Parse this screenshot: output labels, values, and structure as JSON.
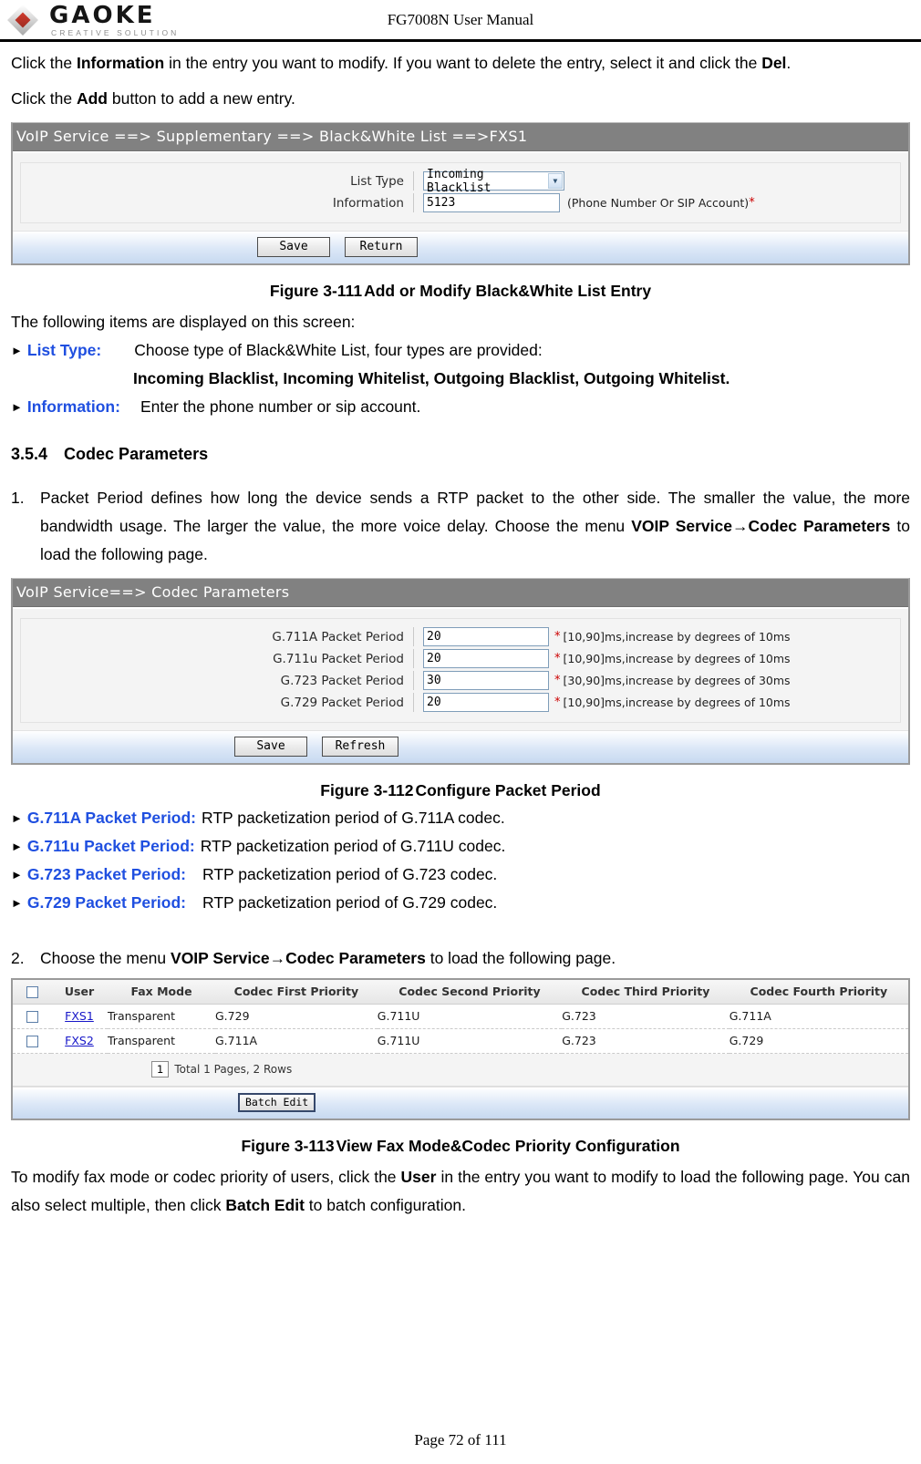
{
  "header": {
    "logo_word": "GAOKE",
    "logo_tagline": "CREATIVE SOLUTION",
    "doc_title": "FG7008N User Manual"
  },
  "intro": {
    "line1_a": "Click the ",
    "line1_b": "Information",
    "line1_c": " in the entry you want to modify. If you want to delete the entry, select it and click the ",
    "line1_d": "Del",
    "line1_e": ".",
    "line2_a": "Click the ",
    "line2_b": "Add",
    "line2_c": " button to add a new entry."
  },
  "screenshot_blacklist": {
    "title": "VoIP Service ==> Supplementary ==> Black&White List ==>FXS1",
    "fields": [
      {
        "label": "List Type",
        "type": "select",
        "value": "Incoming Blacklist",
        "icon": "chevron-down-icon"
      },
      {
        "label": "Information",
        "type": "text",
        "value": "5123",
        "hint": "(Phone Number Or SIP Account)",
        "required_marker": "*"
      }
    ],
    "buttons": [
      "Save",
      "Return"
    ]
  },
  "figure_111": {
    "number": "Figure 3-111",
    "text": "Add or Modify Black&White List Entry"
  },
  "items_intro": "The following items are displayed on this screen:",
  "blacklist_items": [
    {
      "label": "List Type:",
      "desc": "Choose type of Black&White List, four types are provided:",
      "sub": "Incoming Blacklist, Incoming Whitelist, Outgoing Blacklist, Outgoing Whitelist."
    },
    {
      "label": "Information:",
      "desc": "Enter the phone number or sip account."
    }
  ],
  "section": {
    "number": "3.5.4",
    "title": "Codec Parameters"
  },
  "paragraph1": {
    "marker": "1.",
    "text_a": "Packet Period defines how long the device sends a RTP packet to the other side. The smaller the value, the more bandwidth usage. The larger the value, the more voice delay. Choose the menu ",
    "text_b": "VOIP Service→Codec Parameters",
    "text_c": " to load the following page."
  },
  "screenshot_codec": {
    "title": "VoIP Service==> Codec Parameters",
    "fields": [
      {
        "label": "G.711A Packet Period",
        "value": "20",
        "required_marker": "*",
        "hint": "[10,90]ms,increase by degrees of 10ms"
      },
      {
        "label": "G.711u Packet Period",
        "value": "20",
        "required_marker": "*",
        "hint": "[10,90]ms,increase by degrees of 10ms"
      },
      {
        "label": "G.723 Packet Period",
        "value": "30",
        "required_marker": "*",
        "hint": "[30,90]ms,increase by degrees of 30ms"
      },
      {
        "label": "G.729 Packet Period",
        "value": "20",
        "required_marker": "*",
        "hint": "[10,90]ms,increase by degrees of 10ms"
      }
    ],
    "buttons": [
      "Save",
      "Refresh"
    ]
  },
  "figure_112": {
    "number": "Figure 3-112",
    "text": "Configure Packet Period"
  },
  "codec_items": [
    {
      "label": "G.711A Packet Period:",
      "desc": "RTP packetization period of G.711A codec."
    },
    {
      "label": "G.711u Packet Period:",
      "desc": "RTP packetization period of G.711U codec."
    },
    {
      "label": "G.723 Packet Period:",
      "desc": "RTP packetization period of G.723 codec."
    },
    {
      "label": "G.729 Packet Period:",
      "desc": "RTP packetization period of G.729 codec."
    }
  ],
  "paragraph2": {
    "marker": "2.",
    "text_a": "Choose the menu ",
    "text_b": "VOIP Service→Codec Parameters",
    "text_c": " to load the following page."
  },
  "screenshot_table": {
    "columns": [
      "",
      "User",
      "Fax Mode",
      "Codec First Priority",
      "Codec Second Priority",
      "Codec Third Priority",
      "Codec Fourth Priority"
    ],
    "rows": [
      {
        "user": "FXS1",
        "fax_mode": "Transparent",
        "first": "G.729",
        "second": "G.711U",
        "third": "G.723",
        "fourth": "G.711A"
      },
      {
        "user": "FXS2",
        "fax_mode": "Transparent",
        "first": "G.711A",
        "second": "G.711U",
        "third": "G.723",
        "fourth": "G.729"
      }
    ],
    "pager": {
      "page": "1",
      "summary": "Total 1 Pages, 2 Rows"
    },
    "batch_button": "Batch Edit"
  },
  "figure_113": {
    "number": "Figure 3-113",
    "text": "View Fax Mode&Codec Priority Configuration"
  },
  "closing": {
    "text_a": "To modify fax mode or codec priority of users, click the ",
    "text_b": "User",
    "text_c": " in the entry you want to modify to load the following page. You can also select multiple, then click ",
    "text_d": "Batch Edit",
    "text_e": " to batch configuration."
  },
  "footer": {
    "page_label": "Page 72 of 111"
  }
}
